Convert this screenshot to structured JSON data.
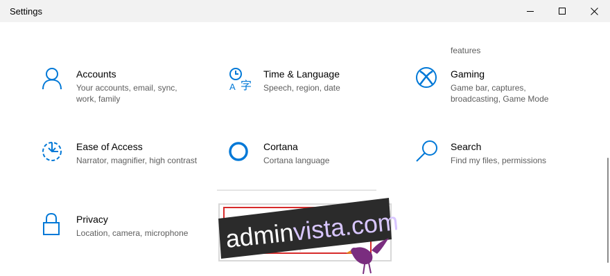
{
  "window": {
    "title": "Settings"
  },
  "partial_item": {
    "description": "features"
  },
  "tiles": [
    {
      "name": "Accounts",
      "description": "Your accounts, email, sync, work, family",
      "icon": "person-icon"
    },
    {
      "name": "Time & Language",
      "description": "Speech, region, date",
      "icon": "time-language-icon"
    },
    {
      "name": "Gaming",
      "description": "Game bar, captures, broadcasting, Game Mode",
      "icon": "xbox-icon"
    },
    {
      "name": "Ease of Access",
      "description": "Narrator, magnifier, high contrast",
      "icon": "ease-of-access-icon"
    },
    {
      "name": "Cortana",
      "description": "Cortana language",
      "icon": "cortana-icon"
    },
    {
      "name": "Search",
      "description": "Find my files, permissions",
      "icon": "search-icon"
    },
    {
      "name": "Privacy",
      "description": "Location, camera, microphone",
      "icon": "lock-icon"
    }
  ],
  "watermark": {
    "text_dark": "admin",
    "text_light": "vista.com"
  },
  "colors": {
    "accent": "#0078d7",
    "titlebar": "#f2f2f2",
    "secondary_text": "#5d5d5d"
  }
}
